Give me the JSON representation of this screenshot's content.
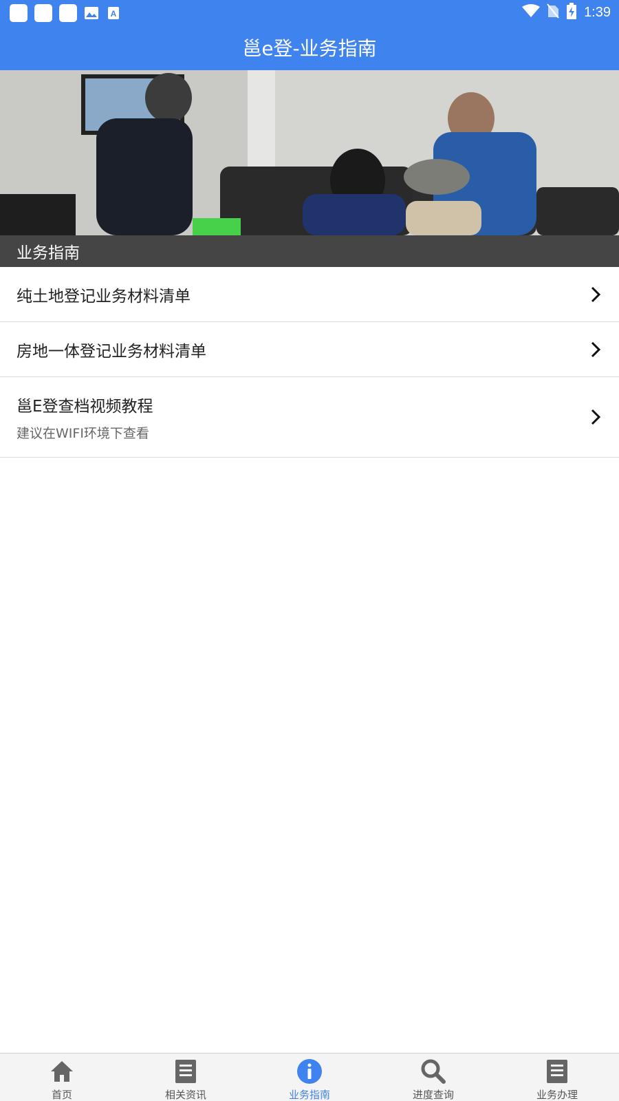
{
  "status_bar": {
    "time": "1:39",
    "icons": [
      "notification-icon",
      "notification-icon",
      "notification-icon",
      "image-icon",
      "text-icon",
      "wifi-icon",
      "no-sim-icon",
      "battery-charging-icon"
    ]
  },
  "app_bar": {
    "title": "邕e登-业务指南"
  },
  "section_header": {
    "title": "业务指南"
  },
  "list": {
    "items": [
      {
        "title": "纯土地登记业务材料清单"
      },
      {
        "title": "房地一体登记业务材料清单"
      },
      {
        "title": "邕E登查档视频教程",
        "subtitle": "建议在WIFI环境下查看"
      }
    ]
  },
  "bottom_nav": {
    "items": [
      {
        "label": "首页",
        "icon": "home-icon"
      },
      {
        "label": "相关资讯",
        "icon": "document-list-icon"
      },
      {
        "label": "业务指南",
        "icon": "info-icon",
        "active": true
      },
      {
        "label": "进度查询",
        "icon": "search-icon"
      },
      {
        "label": "业务办理",
        "icon": "document-list-icon"
      }
    ]
  },
  "colors": {
    "primary": "#3f83ee",
    "section_header": "#454545",
    "inactive_icon": "#666666"
  }
}
